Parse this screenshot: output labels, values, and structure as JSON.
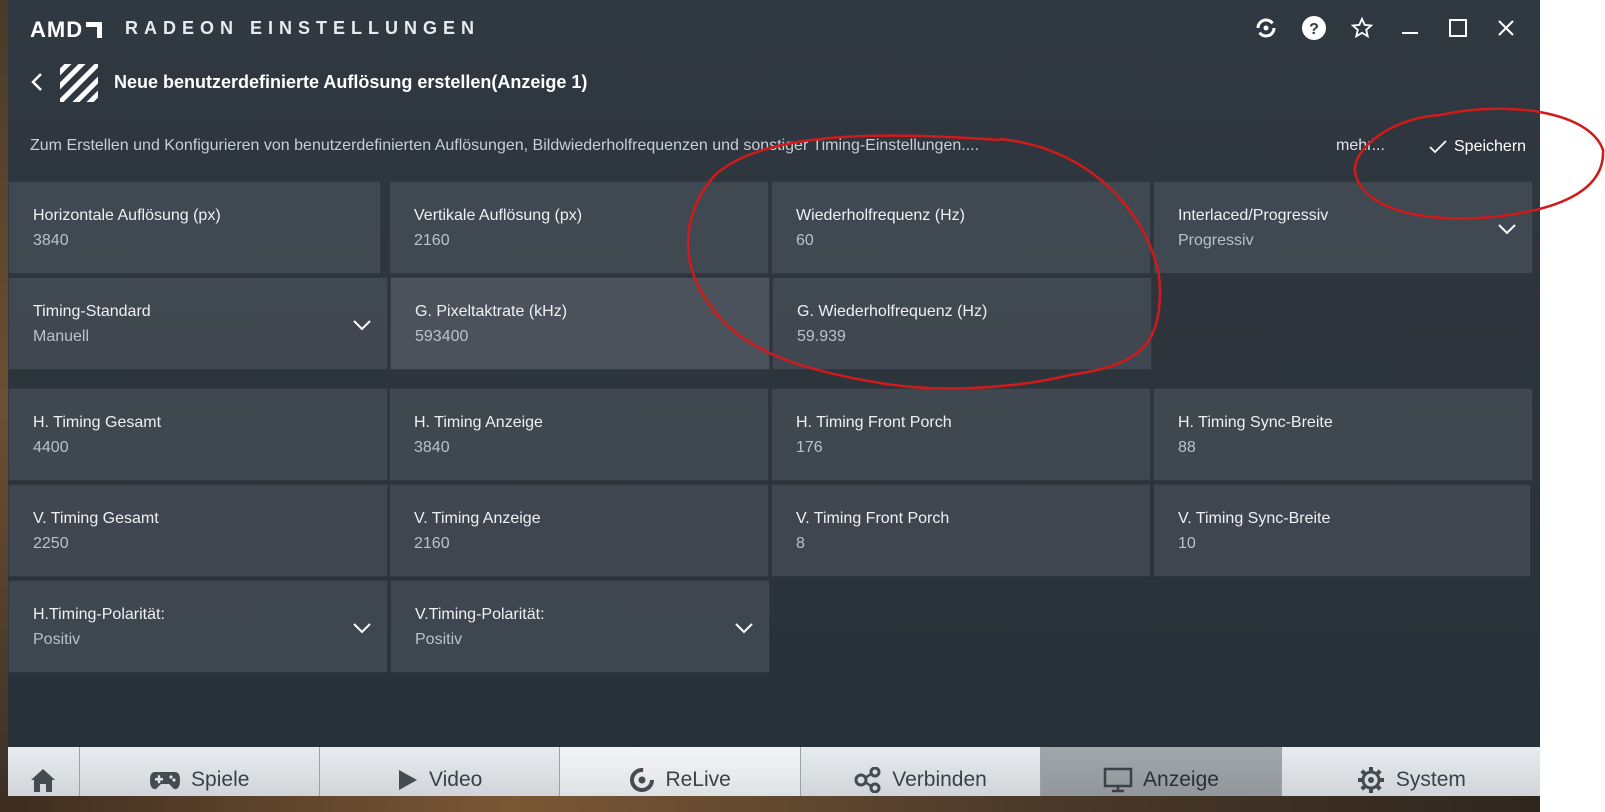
{
  "app": {
    "brand": "AMD",
    "title": "RADEON EINSTELLUNGEN"
  },
  "titlebar_icons": [
    "sync-icon",
    "help-icon",
    "star-icon",
    "minimize-icon",
    "maximize-icon",
    "close-icon"
  ],
  "header": {
    "title": "Neue benutzerdefinierte Auflösung erstellen(Anzeige 1)",
    "description": "Zum Erstellen und Konfigurieren von benutzerdefinierten Auflösungen, Bildwiederholfrequenzen und sonstiger Timing-Einstellungen....",
    "more_label": "mehr...",
    "save_label": "Speichern"
  },
  "settings": {
    "h_res": {
      "label": "Horizontale Auflösung (px)",
      "value": "3840"
    },
    "v_res": {
      "label": "Vertikale Auflösung (px)",
      "value": "2160"
    },
    "refresh": {
      "label": "Wiederholfrequenz (Hz)",
      "value": "60"
    },
    "interlace": {
      "label": "Interlaced/Progressiv",
      "value": "Progressiv"
    },
    "timing_std": {
      "label": "Timing-Standard",
      "value": "Manuell"
    },
    "pixel_clock": {
      "label": "G. Pixeltaktrate (kHz)",
      "value": "593400"
    },
    "g_refresh": {
      "label": "G. Wiederholfrequenz (Hz)",
      "value": "59.939"
    },
    "h_total": {
      "label": "H. Timing Gesamt",
      "value": "4400"
    },
    "h_display": {
      "label": "H. Timing Anzeige",
      "value": "3840"
    },
    "h_front": {
      "label": "H. Timing Front Porch",
      "value": "176"
    },
    "h_sync": {
      "label": "H. Timing Sync-Breite",
      "value": "88"
    },
    "v_total": {
      "label": "V. Timing Gesamt",
      "value": "2250"
    },
    "v_display": {
      "label": "V. Timing Anzeige",
      "value": "2160"
    },
    "v_front": {
      "label": "V. Timing Front Porch",
      "value": "8"
    },
    "v_sync": {
      "label": "V. Timing Sync-Breite",
      "value": "10"
    },
    "h_pol": {
      "label": "H.Timing-Polarität:",
      "value": "Positiv"
    },
    "v_pol": {
      "label": "V.Timing-Polarität:",
      "value": "Positiv"
    }
  },
  "nav": {
    "games": "Spiele",
    "video": "Video",
    "relive": "ReLive",
    "connect": "Verbinden",
    "display": "Anzeige",
    "system": "System"
  },
  "colors": {
    "annotation": "#d11a1a",
    "active_nav": "#9ca1a6"
  }
}
